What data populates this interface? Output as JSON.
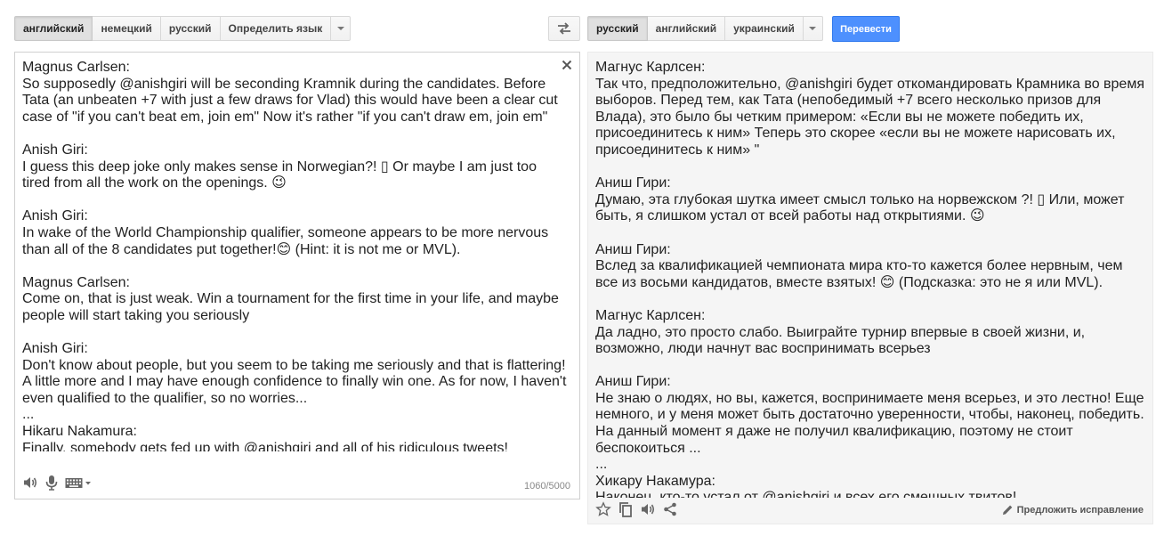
{
  "source_langs": {
    "items": [
      "английский",
      "немецкий",
      "русский",
      "Определить язык"
    ],
    "selected": "английский"
  },
  "target_langs": {
    "items": [
      "русский",
      "английский",
      "украинский"
    ],
    "selected": "русский"
  },
  "translate_label": "Перевести",
  "source": {
    "text": "Magnus Carlsen:\nSo supposedly @anishgiri will be seconding Kramnik during the candidates. Before Tata (an unbeaten +7 with just a few draws for Vlad) this would have been a clear cut case of \"if you can't beat em, join em\" Now it's rather \"if you can't draw em, join em\"\n\nAnish Giri:\nI guess this deep joke only makes sense in Norwegian?! ▯ Or maybe I am just too tired from all the work on the openings. 😉\n\nAnish Giri:\nIn wake of the World Championship qualifier, someone appears to be more nervous than all of the 8 candidates put together!😊 (Hint: it is not me or MVL).\n\nMagnus Carlsen:\nCome on, that is just weak. Win a tournament for the first time in your life, and maybe people will start taking you seriously\n\nAnish Giri:\nDon't know about people, but you seem to be taking me seriously and that is flattering! A little more and I may have enough confidence to finally win one. As for now, I haven't even qualified to the qualifier, so no worries...\n...\nHikaru Nakamura:\nFinally, somebody gets fed up with @anishgiri and all of his ridiculous tweets!",
    "char_count": "1060/5000"
  },
  "translation": {
    "text": "Магнус Карлсен:\nТак что, предположительно, @anishgiri будет откомандировать Крамника во время выборов. Перед тем, как Тата (непобедимый +7 всего несколько призов для Влада), это было бы четким примером: «Если вы не можете победить их, присоединитесь к ним» Теперь это скорее «если вы не можете нарисовать их, присоединитесь к ним» \"\n\nАниш Гири:\nДумаю, эта глубокая шутка имеет смысл только на норвежском ?! ▯ Или, может быть, я слишком устал от всей работы над открытиями. 😉\n\nАниш Гири:\nВслед за квалификацией чемпионата мира кто-то кажется более нервным, чем все из восьми кандидатов, вместе взятых! 😊 (Подсказка: это не я или MVL).\n\nМагнус Карлсен:\nДа ладно, это просто слабо. Выиграйте турнир впервые в своей жизни, и, возможно, люди начнут вас воспринимать всерьез\n\nАниш Гири:\nНе знаю о людях, но вы, кажется, воспринимаете меня всерьез, и это лестно! Еще немного, и у меня может быть достаточно уверенности, чтобы, наконец, победить. На данный момент я даже не получил квалификацию, поэтому не стоит беспокоиться ...\n...\nХикару Накамура:\nНаконец, кто-то устал от @anishgiri и всех его смешных твитов!",
    "suggest_label": "Предложить исправление"
  },
  "colors": {
    "accent": "#4d90fe",
    "target_bg": "#f5f5f5"
  },
  "icons": [
    "swap-icon",
    "close-icon",
    "speaker-icon",
    "microphone-icon",
    "keyboard-icon",
    "star-icon",
    "copy-icon",
    "share-icon",
    "pencil-icon"
  ]
}
